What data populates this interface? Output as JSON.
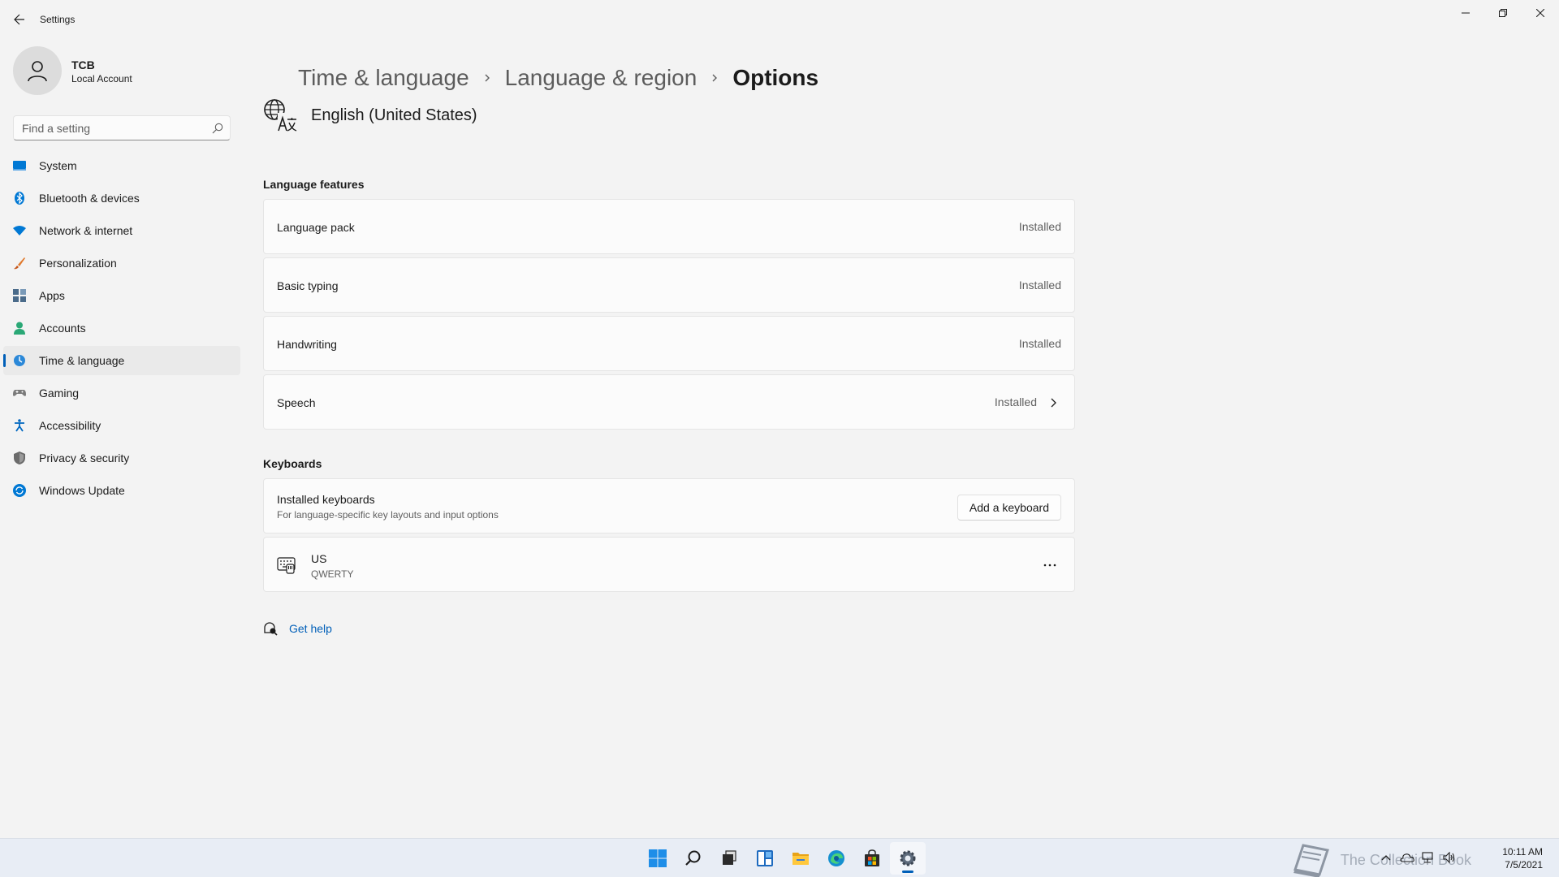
{
  "window": {
    "title": "Settings"
  },
  "profile": {
    "name": "TCB",
    "account_type": "Local Account"
  },
  "search": {
    "placeholder": "Find a setting"
  },
  "sidebar": {
    "items": [
      {
        "label": "System",
        "icon": "system-icon",
        "color": "#0078d4"
      },
      {
        "label": "Bluetooth & devices",
        "icon": "bluetooth-icon",
        "color": "#0078d4"
      },
      {
        "label": "Network & internet",
        "icon": "wifi-icon",
        "color": "#0078d4"
      },
      {
        "label": "Personalization",
        "icon": "brush-icon",
        "color": "#e07a2e"
      },
      {
        "label": "Apps",
        "icon": "apps-icon",
        "color": "#4a6b8a"
      },
      {
        "label": "Accounts",
        "icon": "person-icon",
        "color": "#2aa876"
      },
      {
        "label": "Time & language",
        "icon": "globe-clock-icon",
        "color": "#2b88d8",
        "selected": true
      },
      {
        "label": "Gaming",
        "icon": "gamepad-icon",
        "color": "#7a7a7a"
      },
      {
        "label": "Accessibility",
        "icon": "accessibility-icon",
        "color": "#0067c0"
      },
      {
        "label": "Privacy & security",
        "icon": "shield-icon",
        "color": "#6b6b6b"
      },
      {
        "label": "Windows Update",
        "icon": "update-icon",
        "color": "#0078d4"
      }
    ]
  },
  "breadcrumb": {
    "items": [
      "Time & language",
      "Language & region",
      "Options"
    ]
  },
  "language": {
    "name": "English (United States)"
  },
  "language_features": {
    "heading": "Language features",
    "items": [
      {
        "title": "Language pack",
        "status": "Installed"
      },
      {
        "title": "Basic typing",
        "status": "Installed"
      },
      {
        "title": "Handwriting",
        "status": "Installed"
      },
      {
        "title": "Speech",
        "status": "Installed"
      }
    ]
  },
  "keyboards": {
    "heading": "Keyboards",
    "installed_title": "Installed keyboards",
    "installed_subtitle": "For language-specific key layouts and input options",
    "add_button": "Add a keyboard",
    "layout_name": "US",
    "layout_type": "QWERTY"
  },
  "help": {
    "label": "Get help"
  },
  "taskbar": {
    "apps": [
      "windows-start-icon",
      "search-icon",
      "task-view-icon",
      "widgets-icon",
      "file-explorer-icon",
      "edge-icon",
      "store-icon",
      "settings-icon"
    ],
    "watermark_text": "The Collection Book",
    "time": "10:11 AM",
    "date": "7/5/2021"
  },
  "colors": {
    "accent": "#005fb8",
    "background": "#f3f3f3",
    "card": "#fbfbfb"
  }
}
